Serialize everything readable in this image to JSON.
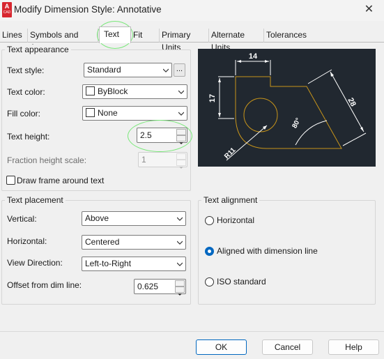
{
  "window": {
    "title": "Modify Dimension Style: Annotative",
    "app_icon_letter": "A",
    "app_icon_sub": "CAD"
  },
  "tabs": [
    {
      "label": "Lines",
      "active": false
    },
    {
      "label": "Symbols and Arrows",
      "active": false
    },
    {
      "label": "Text",
      "active": true
    },
    {
      "label": "Fit",
      "active": false
    },
    {
      "label": "Primary Units",
      "active": false
    },
    {
      "label": "Alternate Units",
      "active": false
    },
    {
      "label": "Tolerances",
      "active": false
    }
  ],
  "text_appearance": {
    "group_label": "Text appearance",
    "text_style_label": "Text style:",
    "text_style_value": "Standard",
    "text_style_browse": "...",
    "text_color_label": "Text color:",
    "text_color_value": "ByBlock",
    "fill_color_label": "Fill color:",
    "fill_color_value": "None",
    "text_height_label": "Text height:",
    "text_height_value": "2.5",
    "fraction_label": "Fraction height scale:",
    "fraction_value": "1",
    "draw_frame_label": "Draw frame around text",
    "draw_frame_checked": false
  },
  "preview": {
    "dim_top": "14",
    "dim_left": "17",
    "dim_right": "28",
    "dim_angle": "80°",
    "dim_radius": "R11",
    "geometry_color": "#c8951a",
    "dim_color": "#ffffff"
  },
  "text_placement": {
    "group_label": "Text placement",
    "vertical_label": "Vertical:",
    "vertical_value": "Above",
    "horizontal_label": "Horizontal:",
    "horizontal_value": "Centered",
    "view_direction_label": "View Direction:",
    "view_direction_value": "Left-to-Right",
    "offset_label": "Offset from dim line:",
    "offset_value": "0.625"
  },
  "text_alignment": {
    "group_label": "Text alignment",
    "options": [
      {
        "label": "Horizontal",
        "checked": false
      },
      {
        "label": "Aligned with dimension line",
        "checked": true
      },
      {
        "label": "ISO standard",
        "checked": false
      }
    ]
  },
  "buttons": {
    "ok": "OK",
    "cancel": "Cancel",
    "help": "Help"
  },
  "colors": {
    "accent": "#0067c0",
    "annotation": "#79e879",
    "preview_bg": "#212830"
  }
}
